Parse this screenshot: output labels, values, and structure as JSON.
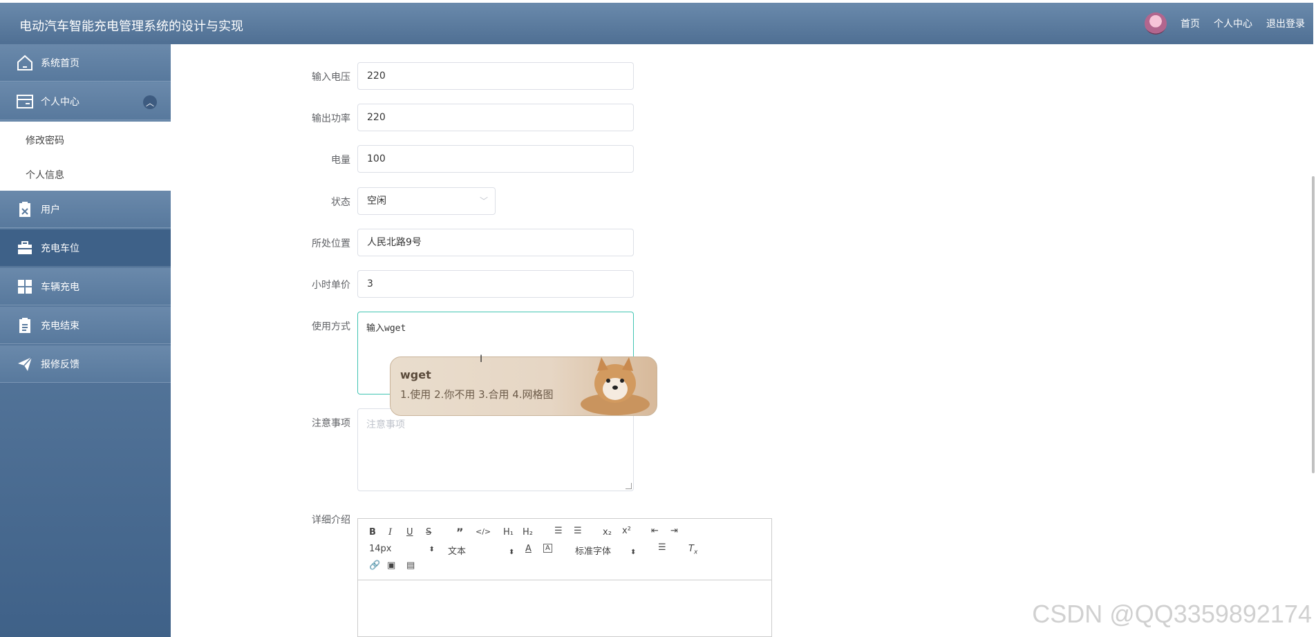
{
  "header": {
    "title": "电动汽车智能充电管理系统的设计与实现",
    "links": [
      "首页",
      "个人中心",
      "退出登录"
    ]
  },
  "sidebar": {
    "items": [
      {
        "label": "系统首页",
        "icon": "home-icon"
      },
      {
        "label": "个人中心",
        "icon": "card-icon"
      },
      {
        "label": "用户",
        "icon": "clipboard-x-icon"
      },
      {
        "label": "充电车位",
        "icon": "briefcase-icon"
      },
      {
        "label": "车辆充电",
        "icon": "grid-icon"
      },
      {
        "label": "充电结束",
        "icon": "clipboard-icon"
      },
      {
        "label": "报修反馈",
        "icon": "paper-plane-icon"
      }
    ],
    "submenu": [
      "修改密码",
      "个人信息"
    ]
  },
  "form": {
    "voltage": {
      "label": "输入电压",
      "value": "220"
    },
    "power": {
      "label": "输出功率",
      "value": "220"
    },
    "charge": {
      "label": "电量",
      "value": "100"
    },
    "status": {
      "label": "状态",
      "value": "空闲"
    },
    "location": {
      "label": "所处位置",
      "value": "人民北路9号"
    },
    "price": {
      "label": "小时单价",
      "value": "3"
    },
    "usage": {
      "label": "使用方式",
      "value": "输入wget"
    },
    "notes": {
      "label": "注意事项",
      "placeholder": "注意事项"
    },
    "detail": {
      "label": "详细介绍"
    }
  },
  "editor": {
    "font_size": "14px",
    "text_type": "文本",
    "font_family": "标准字体"
  },
  "ime": {
    "input": "wget",
    "candidates": "1.使用  2.你不用  3.合用  4.网格图"
  },
  "watermark": "CSDN @QQ3359892174"
}
